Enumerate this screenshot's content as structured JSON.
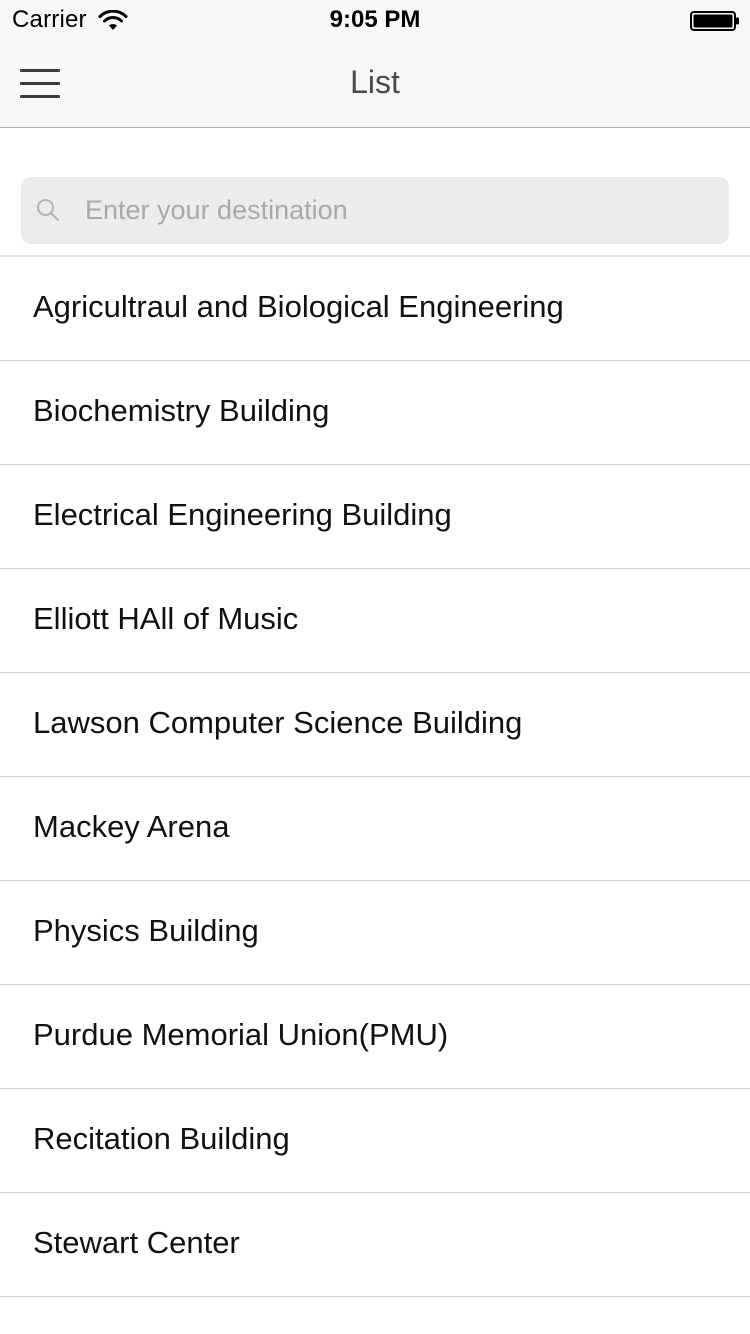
{
  "status_bar": {
    "carrier": "Carrier",
    "time": "9:05 PM",
    "wifi_icon": "wifi-icon",
    "battery_icon": "battery-icon"
  },
  "nav": {
    "title": "List",
    "menu_icon": "hamburger-menu-icon"
  },
  "search": {
    "placeholder": "Enter your destination",
    "value": "",
    "icon": "search-icon"
  },
  "list": {
    "items": [
      {
        "label": "Agricultraul and Biological Engineering"
      },
      {
        "label": "Biochemistry Building"
      },
      {
        "label": "Electrical Engineering Building"
      },
      {
        "label": "Elliott HAll of Music"
      },
      {
        "label": "Lawson Computer Science Building"
      },
      {
        "label": "Mackey Arena"
      },
      {
        "label": "Physics Building"
      },
      {
        "label": "Purdue Memorial Union(PMU)"
      },
      {
        "label": "Recitation Building"
      },
      {
        "label": "Stewart Center"
      }
    ]
  },
  "colors": {
    "bar_background": "#f7f7f7",
    "search_background": "#ececec",
    "separator": "#d0d0d0",
    "text": "#111111",
    "placeholder": "#a9a9a9"
  }
}
